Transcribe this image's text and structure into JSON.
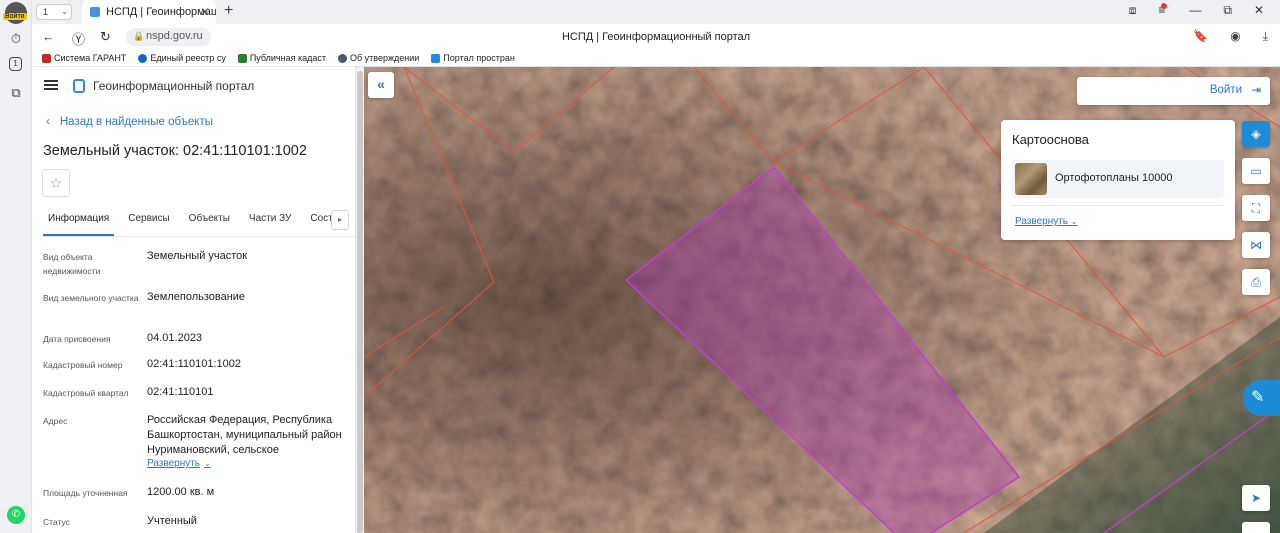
{
  "browser": {
    "profile_label": "Войти",
    "tab_count": "1",
    "tab_title": "НСПД | Геоинформацио",
    "url": "nspd.gov.ru",
    "page_title": "НСПД | Геоинформационный портал",
    "bookmarks": [
      {
        "label": "Система ГАРАНТ",
        "color": "#c62828"
      },
      {
        "label": "Единый реестр су",
        "color": "#1565c0"
      },
      {
        "label": "Публичная кадаст",
        "color": "#2e7d32"
      },
      {
        "label": "Об утверждении",
        "color": "#455a64"
      },
      {
        "label": "Портал простран",
        "color": "#1e88e5"
      }
    ]
  },
  "panel": {
    "portal_name": "Геоинформационный портал",
    "back_link": "Назад в найденные объекты",
    "title": "Земельный участок: 02:41:110101:1002",
    "tabs": [
      "Информация",
      "Сервисы",
      "Объекты",
      "Части ЗУ",
      "Соста"
    ],
    "properties": [
      {
        "label": "Вид объекта недвижимости",
        "value": "Земельный участок"
      },
      {
        "label": "Вид земельного участка",
        "value": "Землепользование"
      },
      {
        "label": "Дата присвоения",
        "value": "04.01.2023"
      },
      {
        "label": "Кадастровый номер",
        "value": "02:41:110101:1002"
      },
      {
        "label": "Кадастровый квартал",
        "value": "02:41:110101"
      },
      {
        "label": "Адрес",
        "value": "Российская Федерация, Республика Башкортостан, муниципальный район Нуримановский, сельское",
        "expand": "Развернуть"
      },
      {
        "label": "Площадь уточненная",
        "value": "1200.00 кв. м"
      },
      {
        "label": "Статус",
        "value": "Учтенный"
      }
    ]
  },
  "map": {
    "login_label": "Войти",
    "basemap_title": "Картооснова",
    "basemap_item": "Ортофотопланы 10000",
    "basemap_expand": "Развернуть",
    "colors": {
      "accent": "#1d8bd6",
      "parcel_highlight": "#b03cb8",
      "boundary": "#e0553a"
    }
  }
}
